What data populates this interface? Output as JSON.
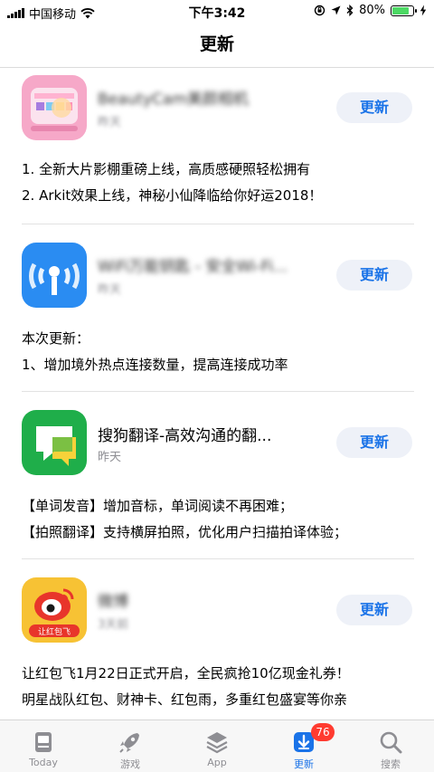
{
  "status_bar": {
    "carrier": "中国移动",
    "time": "下午3:42",
    "battery": "80%",
    "battery_level": 0.8
  },
  "nav": {
    "title": "更新"
  },
  "updates": [
    {
      "app_name": "BeautyCam美颜相机",
      "date": "昨天",
      "button": "更新",
      "notes": [
        "1. 全新大片影棚重磅上线，高质感硬照轻松拥有",
        "2. Arkit效果上线，神秘小仙降临给你好运2018！"
      ]
    },
    {
      "app_name": "WiFi万能钥匙 - 安全Wi-Fi...",
      "date": "昨天",
      "button": "更新",
      "notes": [
        "本次更新：",
        "1、增加境外热点连接数量，提高连接成功率"
      ]
    },
    {
      "app_name": "搜狗翻译-高效沟通的翻...",
      "date": "昨天",
      "button": "更新",
      "notes": [
        "【单词发音】增加音标，单词阅读不再困难；",
        "【拍照翻译】支持横屏拍照，优化用户扫描拍译体验；"
      ]
    },
    {
      "app_name": "微博",
      "date": "3天前",
      "button": "更新",
      "notes": [
        "让红包飞1月22日正式开启，全民疯抢10亿现金礼券！",
        "明星战队红包、财神卡、红包雨，多重红包盛宴等你亲"
      ]
    }
  ],
  "tab_bar": {
    "tabs": [
      {
        "label": "Today",
        "icon": "today-icon"
      },
      {
        "label": "游戏",
        "icon": "rocket-icon"
      },
      {
        "label": "App",
        "icon": "app-stack-icon"
      },
      {
        "label": "更新",
        "icon": "download-icon",
        "badge": "76",
        "active": true
      },
      {
        "label": "搜索",
        "icon": "search-icon"
      }
    ]
  },
  "weibo_icon_text": "让红包飞",
  "colors": {
    "accent": "#1a73e8",
    "badge": "#ff3b30",
    "battery_fill": "#4cd964"
  }
}
